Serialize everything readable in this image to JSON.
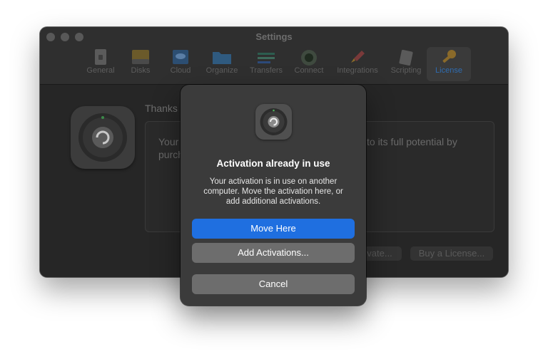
{
  "window": {
    "title": "Settings",
    "toolbar": [
      {
        "label": "General",
        "icon": "general-icon"
      },
      {
        "label": "Disks",
        "icon": "disks-icon"
      },
      {
        "label": "Cloud",
        "icon": "cloud-icon"
      },
      {
        "label": "Organize",
        "icon": "folder-icon"
      },
      {
        "label": "Transfers",
        "icon": "transfers-icon"
      },
      {
        "label": "Connect",
        "icon": "connect-icon"
      },
      {
        "label": "Integrations",
        "icon": "rocket-icon"
      },
      {
        "label": "Scripting",
        "icon": "script-icon"
      },
      {
        "label": "License",
        "icon": "key-icon",
        "active": true
      }
    ],
    "content": {
      "thanks_text": "Thanks f",
      "info_line1": "Your",
      "info_line2": "purch",
      "info_line1_right": "to its full potential by",
      "button_activate": "vate...",
      "button_buy": "Buy a License..."
    }
  },
  "dialog": {
    "title": "Activation already in use",
    "message_lines": [
      "Your activation is in use on another",
      "computer. Move the activation here, or",
      "add additional activations."
    ],
    "buttons": {
      "primary": "Move Here",
      "secondary": "Add Activations...",
      "cancel": "Cancel"
    }
  },
  "colors": {
    "accent": "#1f6fe0",
    "window_bg": "#252525",
    "dialog_bg": "#3b3b3b"
  }
}
